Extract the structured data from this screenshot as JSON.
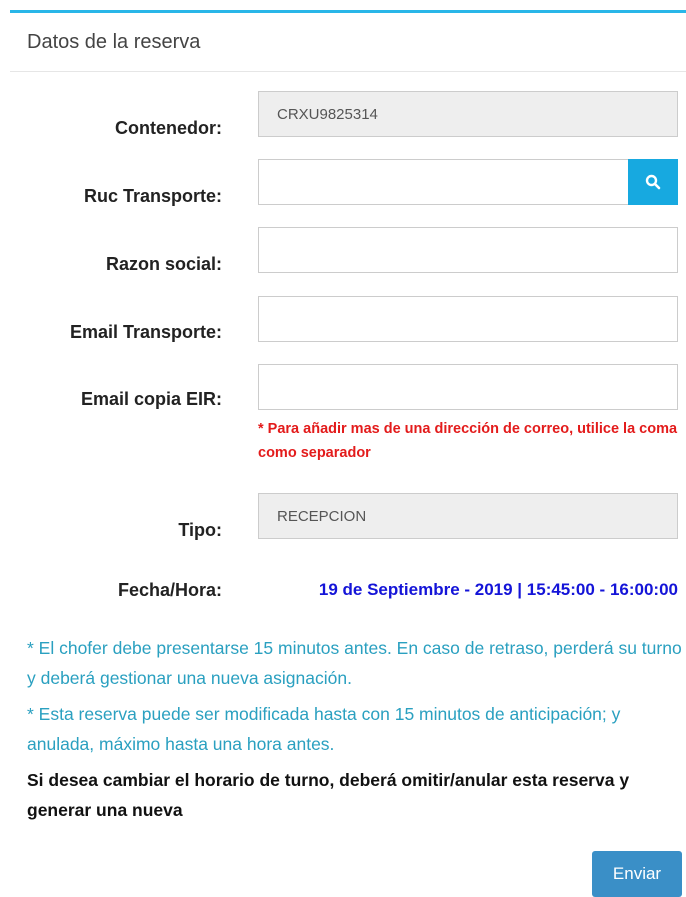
{
  "panel": {
    "title": "Datos de la reserva"
  },
  "form": {
    "contenedor": {
      "label": "Contenedor:",
      "value": "CRXU9825314"
    },
    "ruc": {
      "label": "Ruc Transporte:",
      "value": ""
    },
    "razon": {
      "label": "Razon social:",
      "value": ""
    },
    "email": {
      "label": "Email Transporte:",
      "value": ""
    },
    "email_copy": {
      "label": "Email copia EIR:",
      "value": "",
      "note": "* Para añadir mas de una dirección de correo, utilice la coma como separador"
    },
    "tipo": {
      "label": "Tipo:",
      "value": "RECEPCION"
    },
    "fecha": {
      "label": "Fecha/Hora:",
      "value": "19 de Septiembre - 2019 | 15:45:00 - 16:00:00"
    }
  },
  "notes": {
    "info1": "* El chofer debe presentarse 15 minutos antes. En caso de retraso, perderá su turno y deberá gestionar una nueva asignación.",
    "info2": "* Esta reserva puede ser modificada hasta con 15 minutos de anticipación; y anulada, máximo hasta una hora antes.",
    "warning": "Si desea cambiar el horario de turno, deberá omitir/anular esta reserva y generar una nueva"
  },
  "actions": {
    "submit_label": "Enviar"
  },
  "icons": {
    "search": "search-icon"
  },
  "colors": {
    "accent": "#29b6e8",
    "search_button": "#17a9e0",
    "submit_button": "#3a8fc7",
    "note_red": "#e31b1b",
    "datetime_blue": "#1414d8",
    "info_text": "#2aa0c0"
  }
}
